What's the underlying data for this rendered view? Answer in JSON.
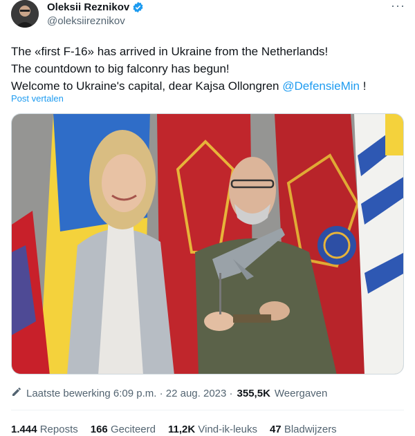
{
  "author": {
    "display_name": "Oleksii Reznikov",
    "handle": "@oleksiireznikov",
    "more": "···"
  },
  "tweet": {
    "line1": "The «first F-16» has arrived in Ukraine from the Netherlands!",
    "line2": "The countdown to big falconry has begun!",
    "line3_text": "Welcome to Ukraine's capital, dear Kajsa Ollongren ",
    "line3_mention": "@DefensieMin",
    "line3_end": " !",
    "translate": "Post vertalen"
  },
  "meta": {
    "edited_label": "Laatste bewerking 6:09 p.m. · 22 aug. 2023 ·",
    "views_count": "355,5K",
    "views_label": "Weergaven"
  },
  "stats": {
    "reposts_count": "1.444",
    "reposts_label": "Reposts",
    "quotes_count": "166",
    "quotes_label": "Geciteerd",
    "likes_count": "11,2K",
    "likes_label": "Vind-ik-leuks",
    "bookmarks_count": "47",
    "bookmarks_label": "Bladwijzers"
  },
  "colors": {
    "link": "#1d9bf0",
    "muted": "#536471",
    "verified": "#1d9bf0"
  }
}
